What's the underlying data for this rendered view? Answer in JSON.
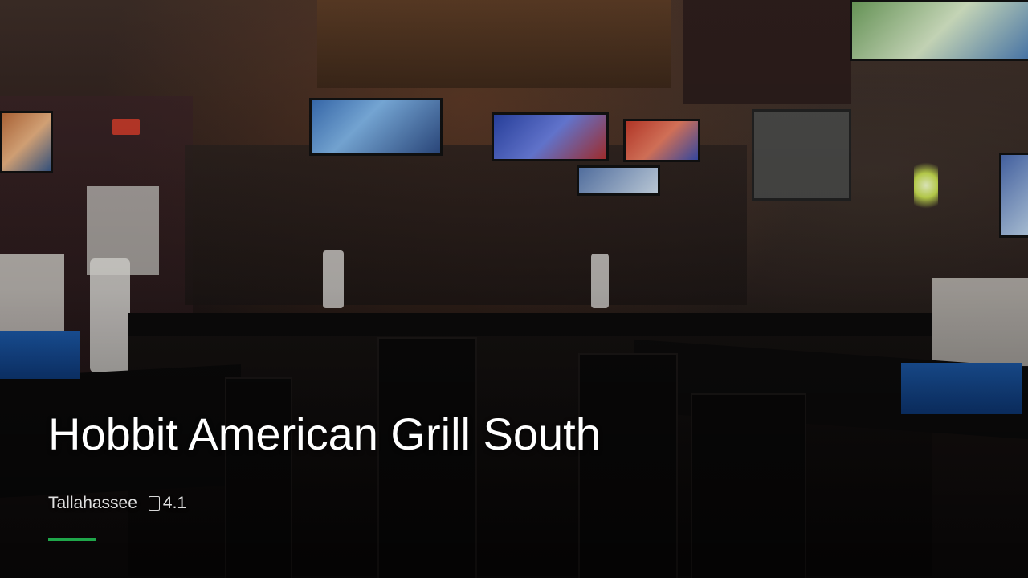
{
  "listing": {
    "name": "Hobbit American Grill South",
    "city": "Tallahassee",
    "rating": "4.1",
    "rating_icon": "star-icon"
  },
  "colors": {
    "accent": "#1fa64a",
    "title_text": "#ffffff",
    "meta_text": "#e0e0e0"
  }
}
